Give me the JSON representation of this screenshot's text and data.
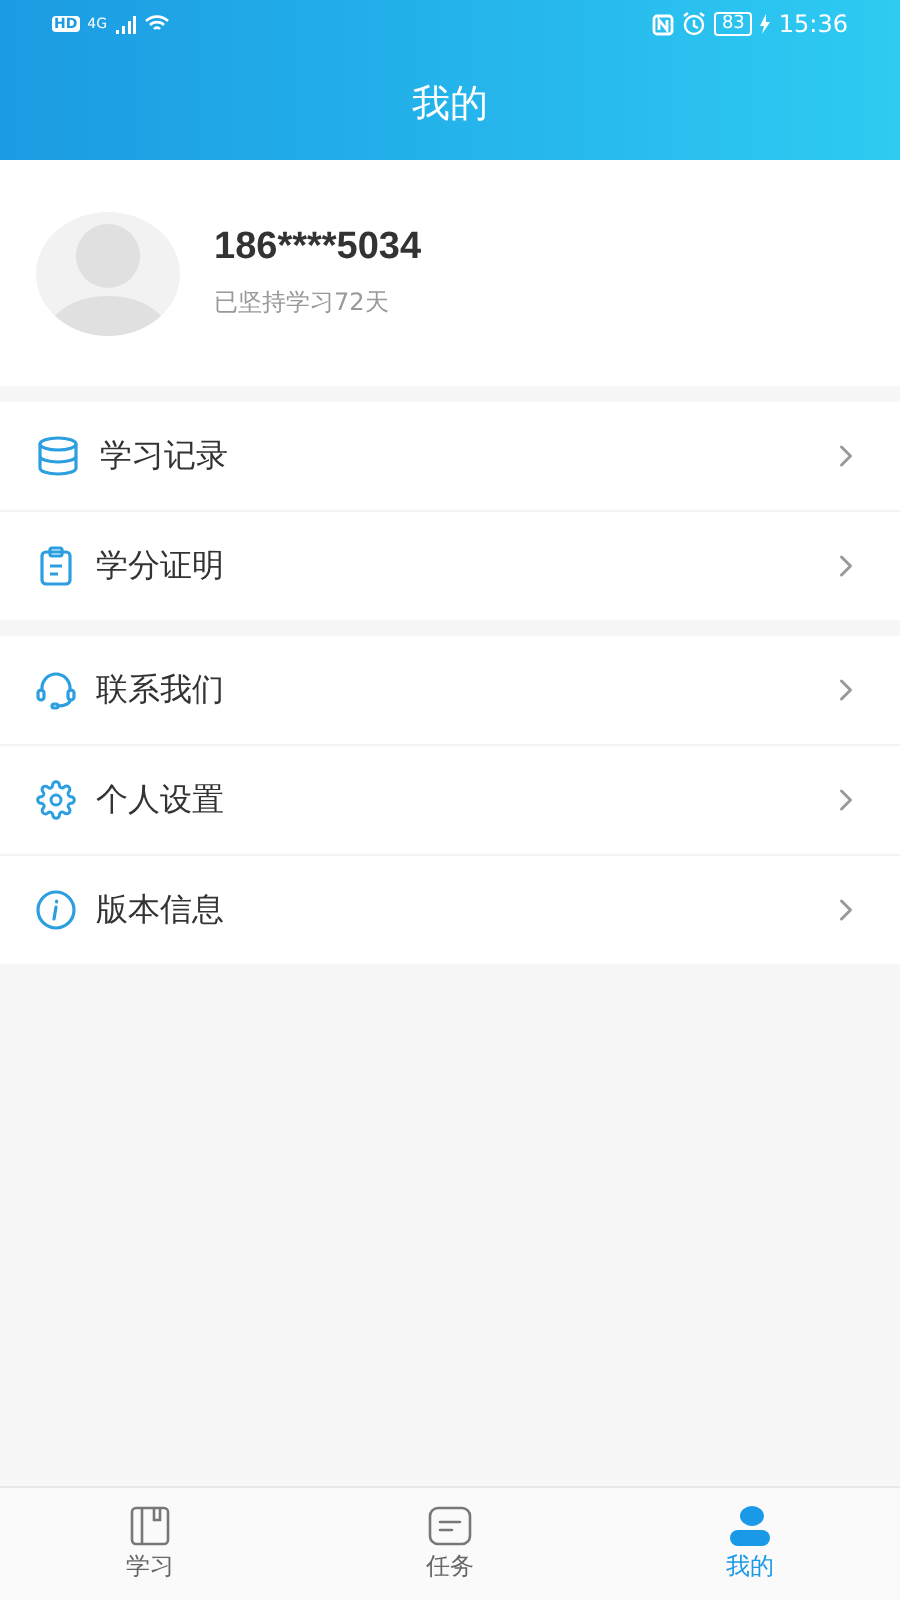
{
  "status_bar": {
    "hd": "HD",
    "network": "4G",
    "battery": "83",
    "time": "15:36"
  },
  "header": {
    "title": "我的"
  },
  "profile": {
    "phone": "186****5034",
    "subtitle": "已坚持学习72天"
  },
  "menu_groups": [
    {
      "items": [
        {
          "label": "学习记录"
        },
        {
          "label": "学分证明"
        }
      ]
    },
    {
      "items": [
        {
          "label": "联系我们"
        },
        {
          "label": "个人设置"
        },
        {
          "label": "版本信息"
        }
      ]
    }
  ],
  "tabs": [
    {
      "label": "学习",
      "selected": false
    },
    {
      "label": "任务",
      "selected": false
    },
    {
      "label": "我的",
      "selected": true
    }
  ]
}
